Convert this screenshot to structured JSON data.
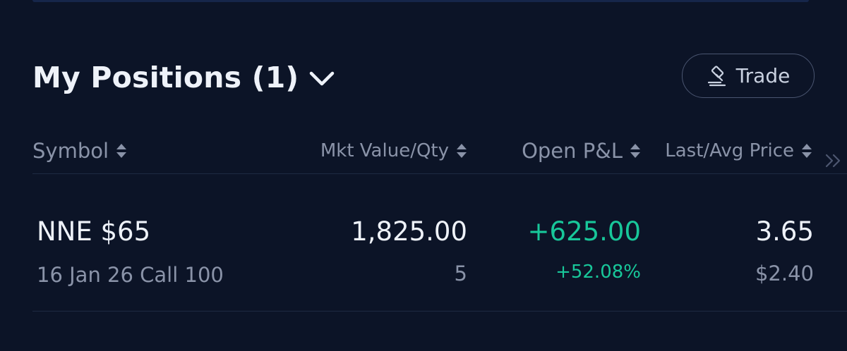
{
  "header": {
    "title": "My Positions (1)",
    "trade_label": "Trade"
  },
  "columns": {
    "symbol": "Symbol",
    "mkt_value_qty": "Mkt Value/Qty",
    "open_pnl": "Open P&L",
    "last_avg_price": "Last/Avg Price"
  },
  "positions": [
    {
      "symbol": "NNE $65",
      "contract": "16 Jan 26 Call 100",
      "market_value": "1,825.00",
      "quantity": "5",
      "open_pnl": "+625.00",
      "open_pnl_pct": "+52.08%",
      "last_price": "3.65",
      "avg_price": "$2.40"
    }
  ],
  "icons": {
    "dropdown": "chevron-down-icon",
    "trade": "gavel-icon",
    "sort": "sort-icon",
    "more": "double-chevron-right-icon"
  },
  "colors": {
    "background": "#0c1427",
    "positive": "#18c79a",
    "muted_text": "#8a93a8",
    "primary_text": "#eef2f9"
  }
}
